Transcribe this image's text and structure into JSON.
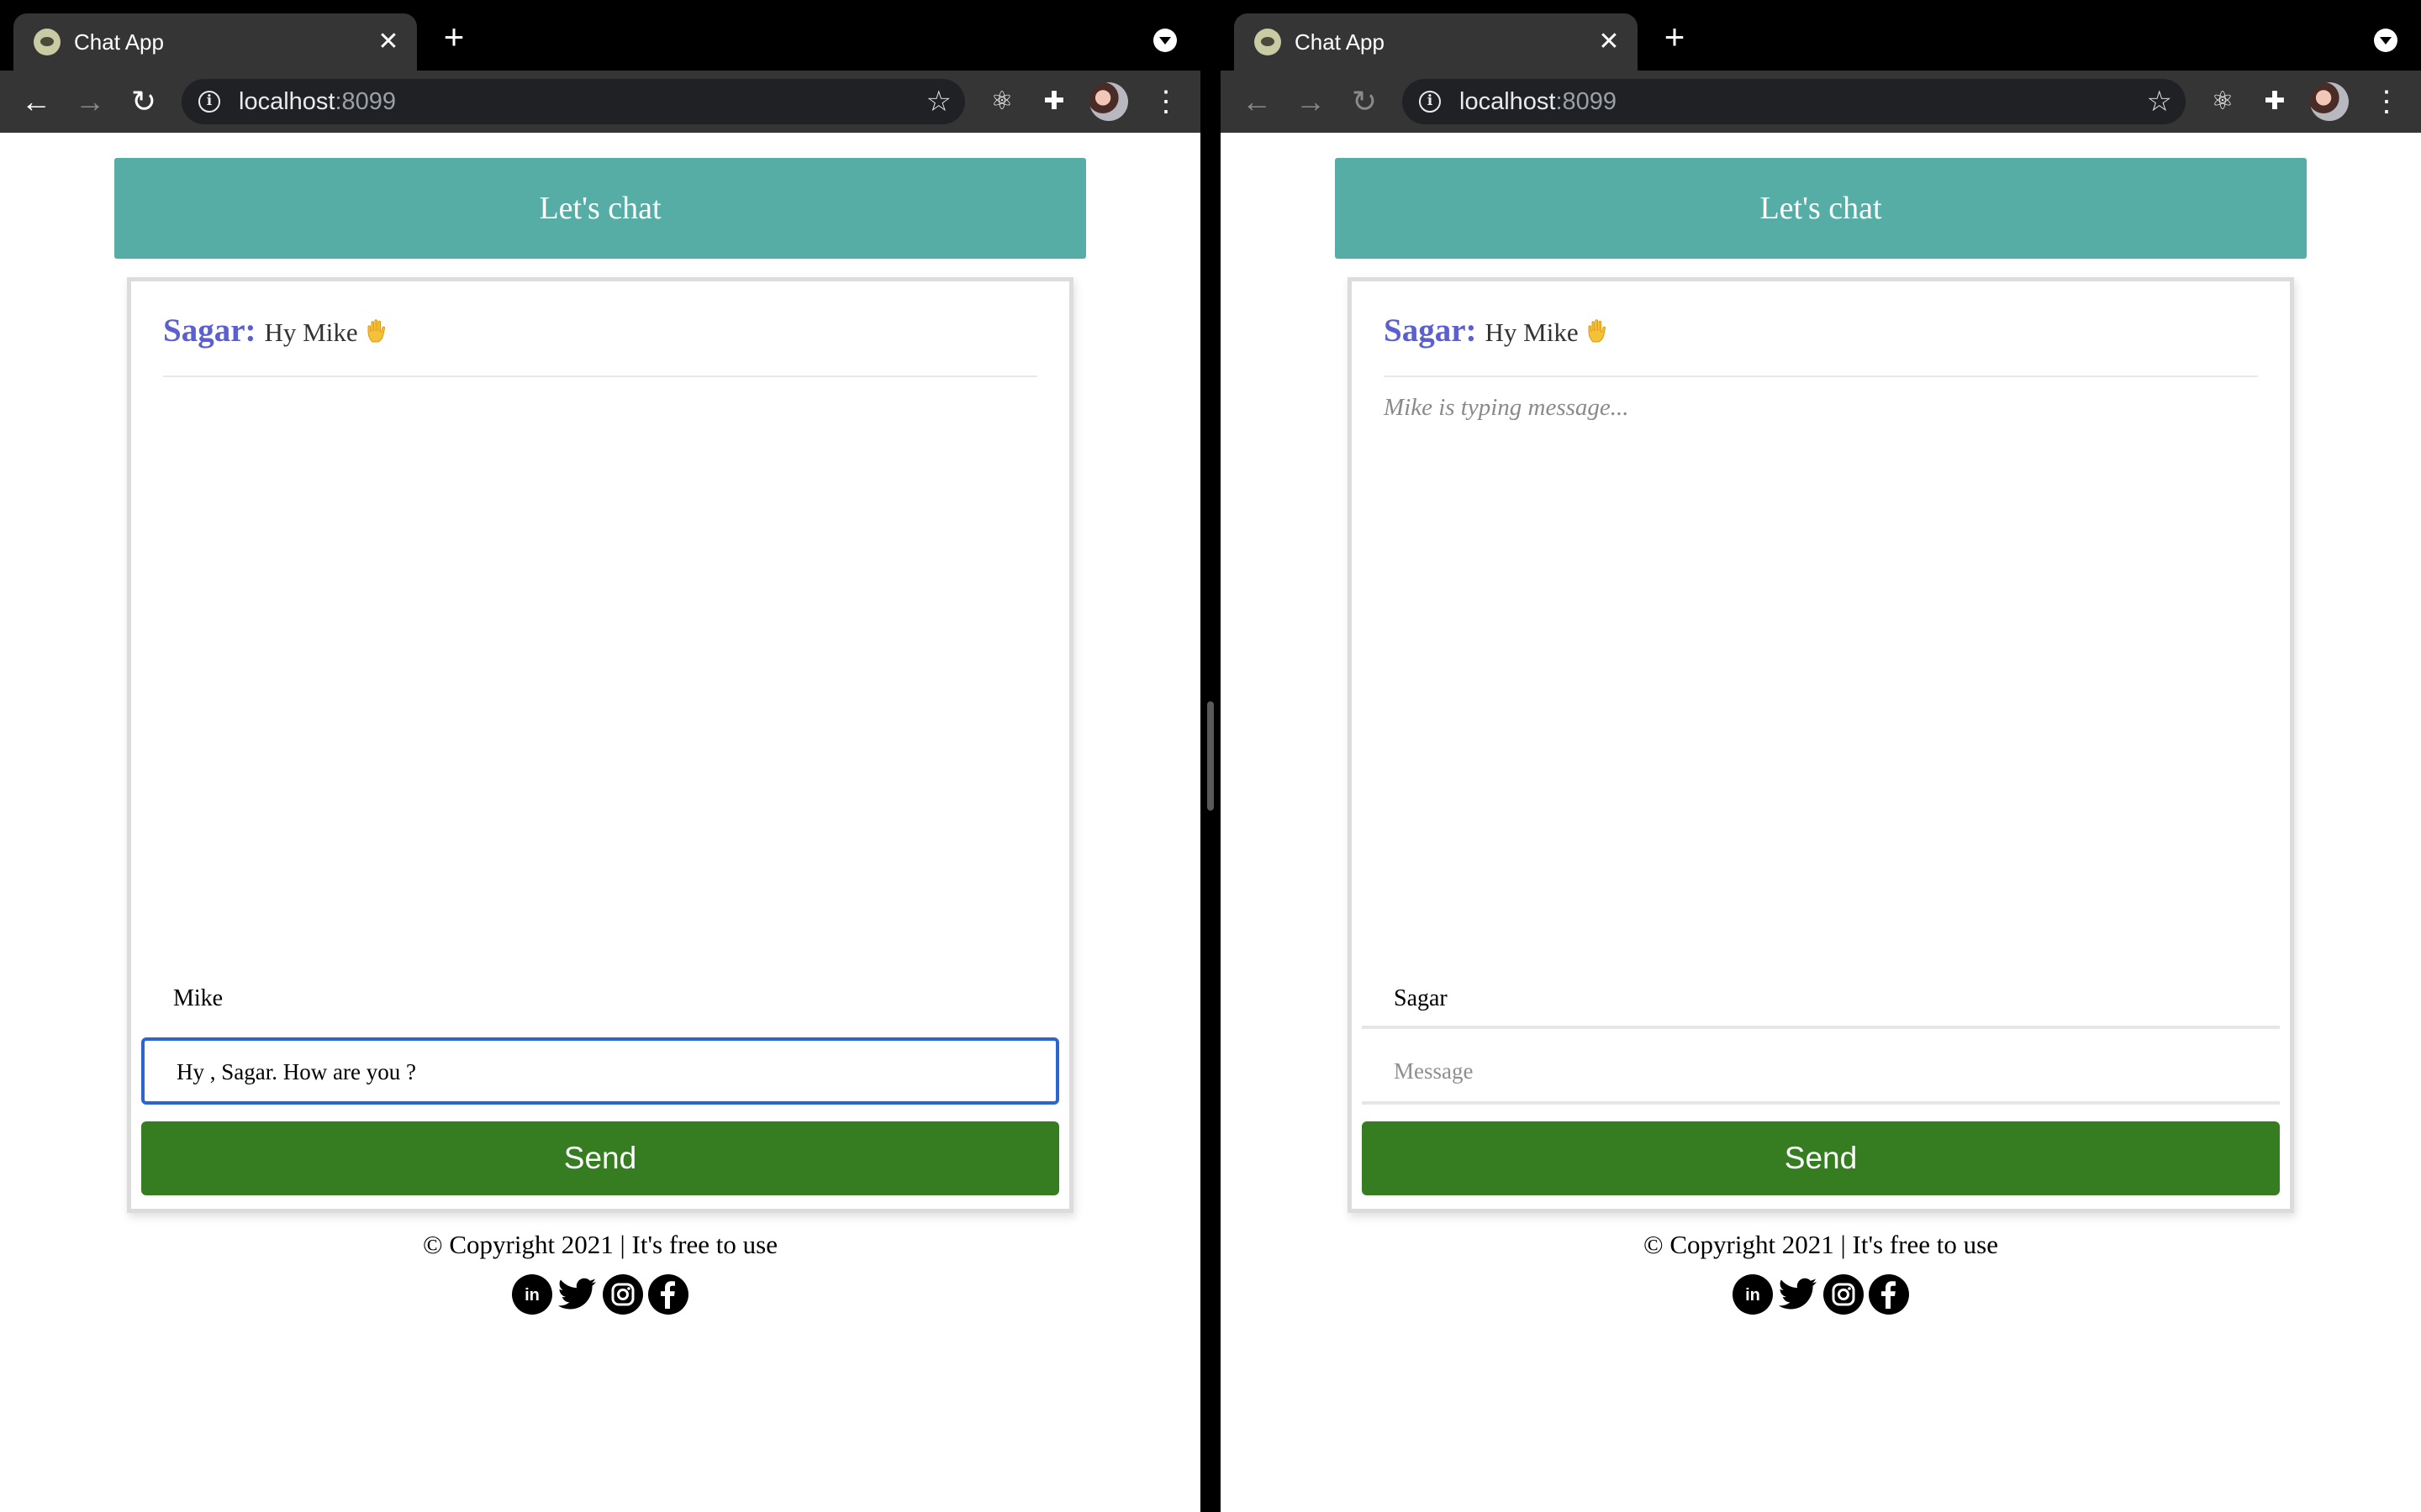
{
  "browser": {
    "tab_title": "Chat App",
    "tab_close": "✕",
    "new_tab": "+",
    "url_host": "localhost",
    "url_port": ":8099",
    "back": "←",
    "forward": "→",
    "reload": "↻",
    "star": "☆",
    "react_devtools": "⚛",
    "extensions": "✚",
    "menu": "⋮"
  },
  "header": {
    "title": "Let's chat"
  },
  "chat": {
    "messages": [
      {
        "user": "Sagar:",
        "text": "Hy Mike"
      }
    ]
  },
  "left_window": {
    "name_value": "Mike",
    "message_value": "Hy , Sagar. How are you ?",
    "send_label": "Send"
  },
  "right_window": {
    "typing_indicator": "Mike is typing message...",
    "name_value": "Sagar",
    "message_placeholder": "Message",
    "send_label": "Send"
  },
  "footer": {
    "copyright": "© Copyright 2021 | It's free to use",
    "social_icons": [
      "linkedin-icon",
      "twitter-icon",
      "instagram-icon",
      "facebook-icon"
    ]
  },
  "colors": {
    "header_bg": "#55ada6",
    "send_bg": "#367d22",
    "username": "#5b5fd0",
    "focus_border": "#2b66d0"
  }
}
